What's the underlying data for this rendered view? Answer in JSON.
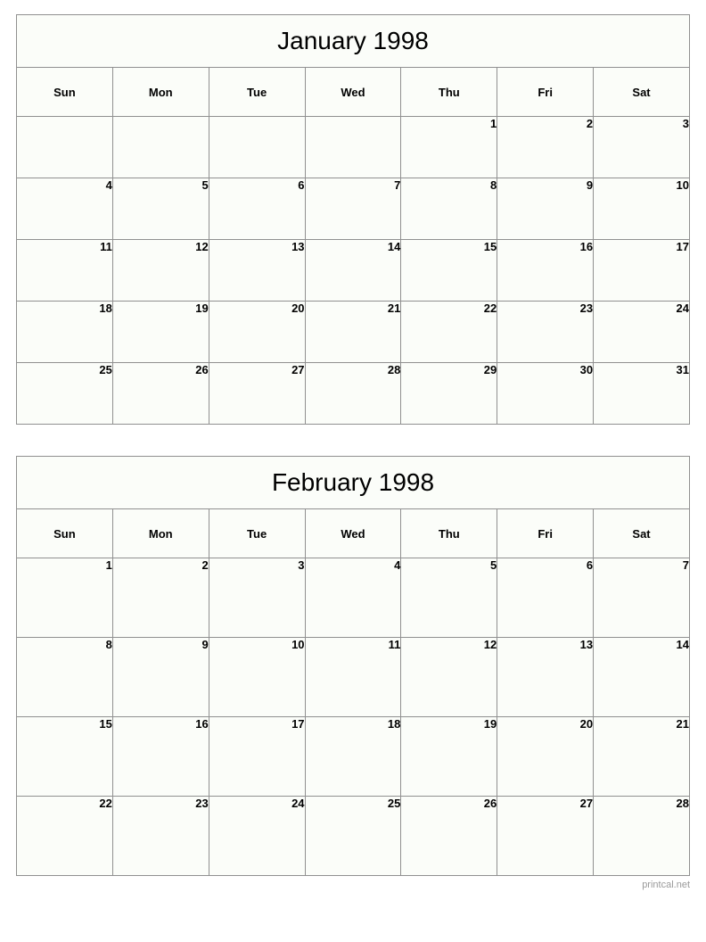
{
  "page": {
    "background_color": "#ffffff",
    "cell_background_color": "#fbfdf9",
    "border_color": "#909090",
    "text_color": "#000000",
    "footer_color": "#9a9a9a"
  },
  "footer": {
    "label": "printcal.net"
  },
  "calendars": [
    {
      "title": "January 1998",
      "weekdays": [
        "Sun",
        "Mon",
        "Tue",
        "Wed",
        "Thu",
        "Fri",
        "Sat"
      ],
      "weeks": [
        [
          "",
          "",
          "",
          "",
          "1",
          "2",
          "3"
        ],
        [
          "4",
          "5",
          "6",
          "7",
          "8",
          "9",
          "10"
        ],
        [
          "11",
          "12",
          "13",
          "14",
          "15",
          "16",
          "17"
        ],
        [
          "18",
          "19",
          "20",
          "21",
          "22",
          "23",
          "24"
        ],
        [
          "25",
          "26",
          "27",
          "28",
          "29",
          "30",
          "31"
        ]
      ]
    },
    {
      "title": "February 1998",
      "weekdays": [
        "Sun",
        "Mon",
        "Tue",
        "Wed",
        "Thu",
        "Fri",
        "Sat"
      ],
      "weeks": [
        [
          "1",
          "2",
          "3",
          "4",
          "5",
          "6",
          "7"
        ],
        [
          "8",
          "9",
          "10",
          "11",
          "12",
          "13",
          "14"
        ],
        [
          "15",
          "16",
          "17",
          "18",
          "19",
          "20",
          "21"
        ],
        [
          "22",
          "23",
          "24",
          "25",
          "26",
          "27",
          "28"
        ]
      ]
    }
  ]
}
